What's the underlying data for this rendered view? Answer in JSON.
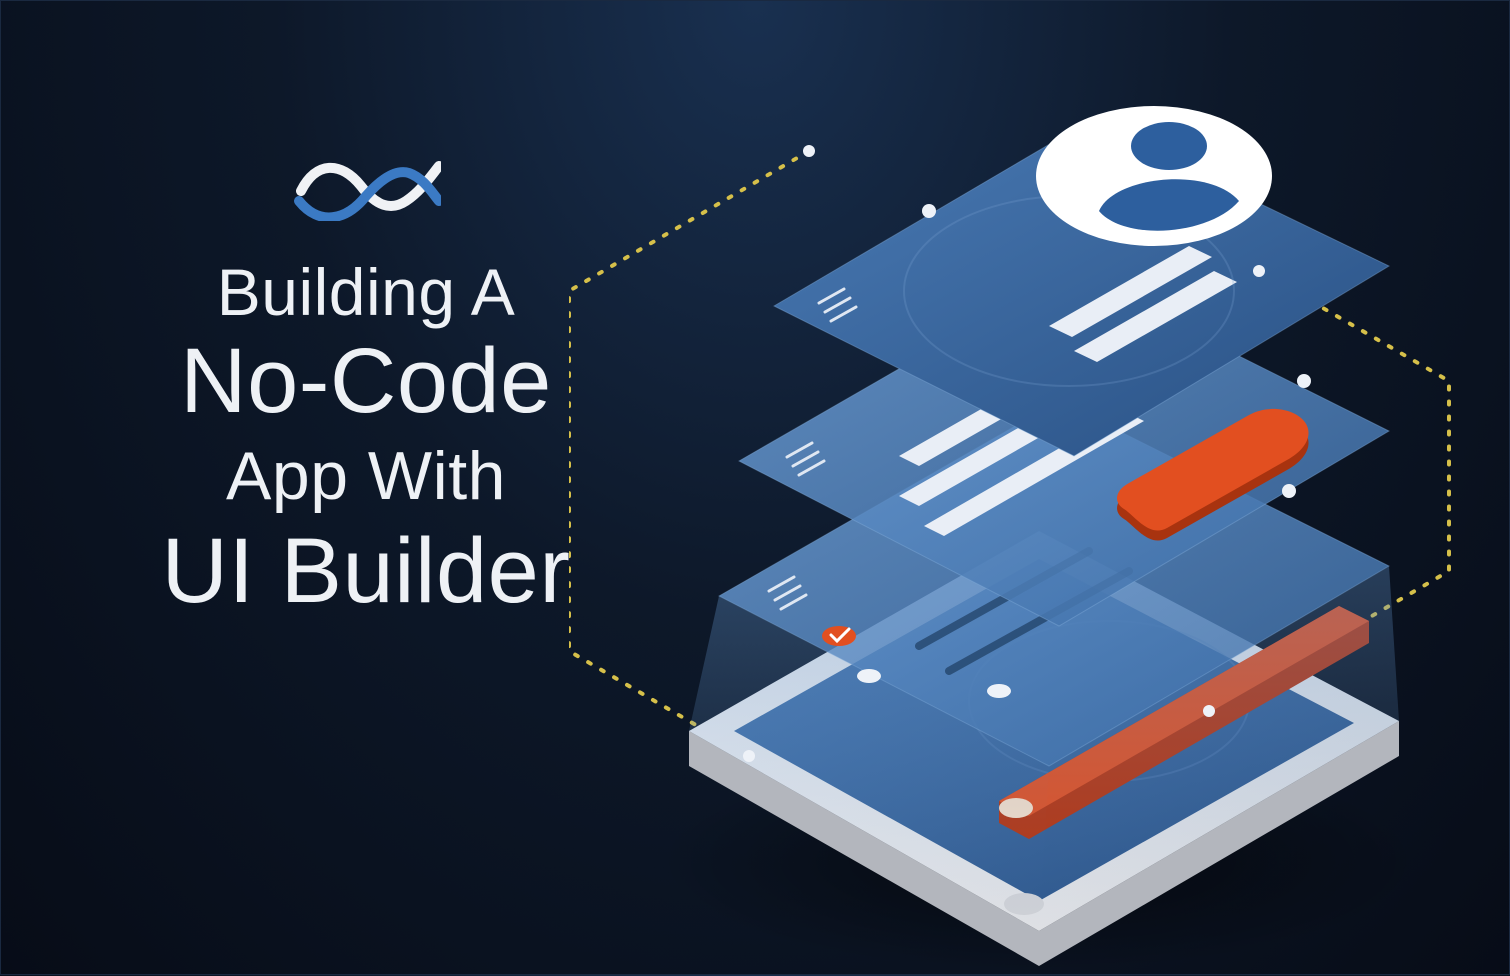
{
  "title": {
    "line1": "Building A",
    "line2": "No-Code",
    "line3": "App With",
    "line4": "UI Builder"
  },
  "logo": {
    "name": "backendless-wave-logo"
  },
  "illustration": {
    "description": "Isometric phone with three layered UI panels, profile avatar, orange buttons, slider bar, and dotted yellow connection paths",
    "accent_color": "#e04b1e",
    "panel_color": "#2d5f9e",
    "device_color": "#e8e9ec",
    "dotted_line_color": "#d6c04a"
  }
}
